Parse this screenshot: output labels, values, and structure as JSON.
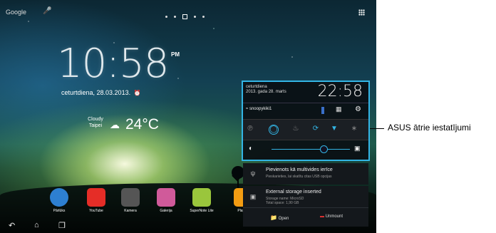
{
  "statusbar": {
    "google_label": "Google"
  },
  "clock": {
    "time": "10:58",
    "ampm": "PM",
    "date": "ceturtdiena, 28.03.2013."
  },
  "weather": {
    "condition": "Cloudy",
    "city": "Taipei",
    "temperature": "24°C"
  },
  "dock_apps": [
    {
      "label": "Pārlūks",
      "icon": "globe-icon",
      "color": "#2d7fd1"
    },
    {
      "label": "YouTube",
      "icon": "youtube-icon",
      "color": "#e52d27"
    },
    {
      "label": "Kamera",
      "icon": "camera-icon",
      "color": "#555555"
    },
    {
      "label": "Galerija",
      "icon": "gallery-icon",
      "color": "#d05a9a"
    },
    {
      "label": "SuperNote Lite",
      "icon": "supernote-icon",
      "color": "#9ac63c"
    },
    {
      "label": "Play m",
      "icon": "play-music-icon",
      "color": "#f39c12"
    }
  ],
  "quick_settings": {
    "day": "ceturtdiena",
    "date": "2013. gada 28. marts",
    "time": "22:58",
    "wifi_name": "snoopykiki1"
  },
  "notifications": [
    {
      "title": "Pievienots kā multivides ierīce",
      "subtitle": "Pieskarieties, lai skatītu citas USB opcijas"
    },
    {
      "title": "External storage inserted",
      "subtitle_1": "Storage name: MicroSD",
      "subtitle_2": "Total space: 1,90 GB"
    }
  ],
  "notif_actions": {
    "open": "Open",
    "unmount": "Unmount"
  },
  "callout": {
    "text": "ASUS ātrie iestatījumi"
  },
  "colors": {
    "accent": "#33b5e5"
  }
}
